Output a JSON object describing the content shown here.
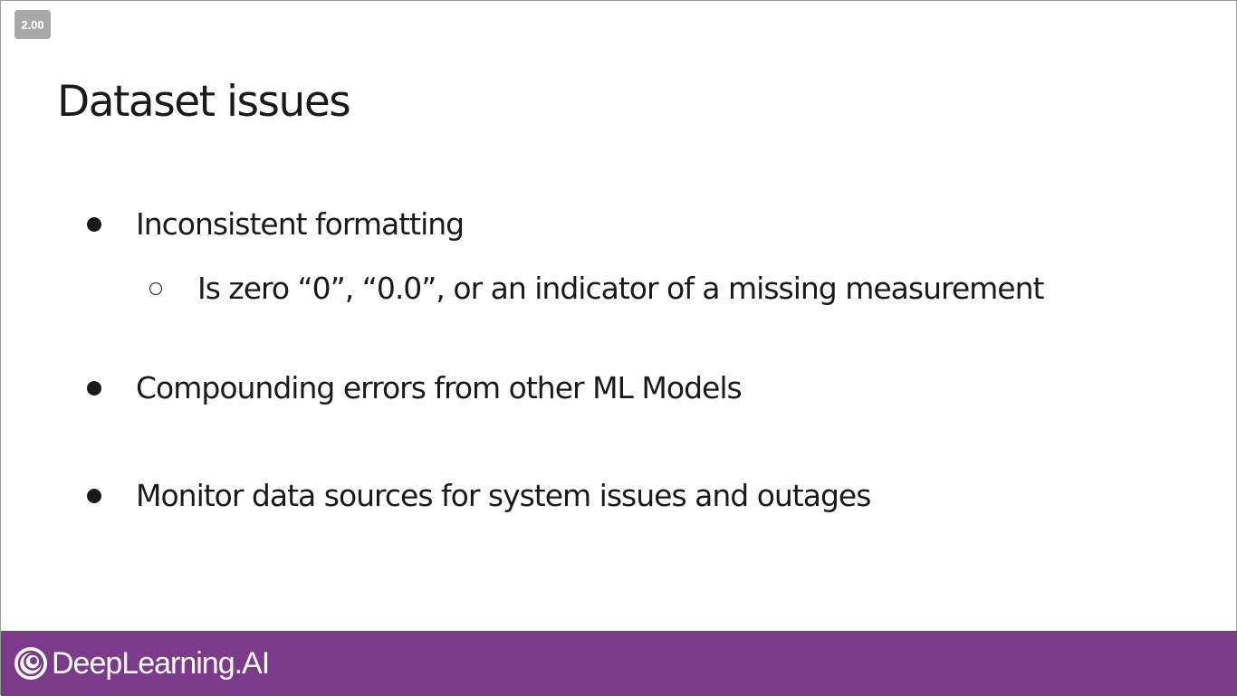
{
  "player": {
    "speed_label": "2.00"
  },
  "slide": {
    "title": "Dataset issues",
    "bullets": [
      {
        "text": "Inconsistent formatting",
        "subitems": [
          {
            "text": "Is zero “0”, “0.0”, or an indicator of a missing measurement"
          }
        ]
      },
      {
        "text": "Compounding errors from other ML Models"
      },
      {
        "text": "Monitor data sources for system issues and outages"
      }
    ]
  },
  "footer": {
    "brand": "DeepLearning.AI",
    "icon": "deeplearning-logo-icon",
    "background_color": "#7b3a8a"
  }
}
